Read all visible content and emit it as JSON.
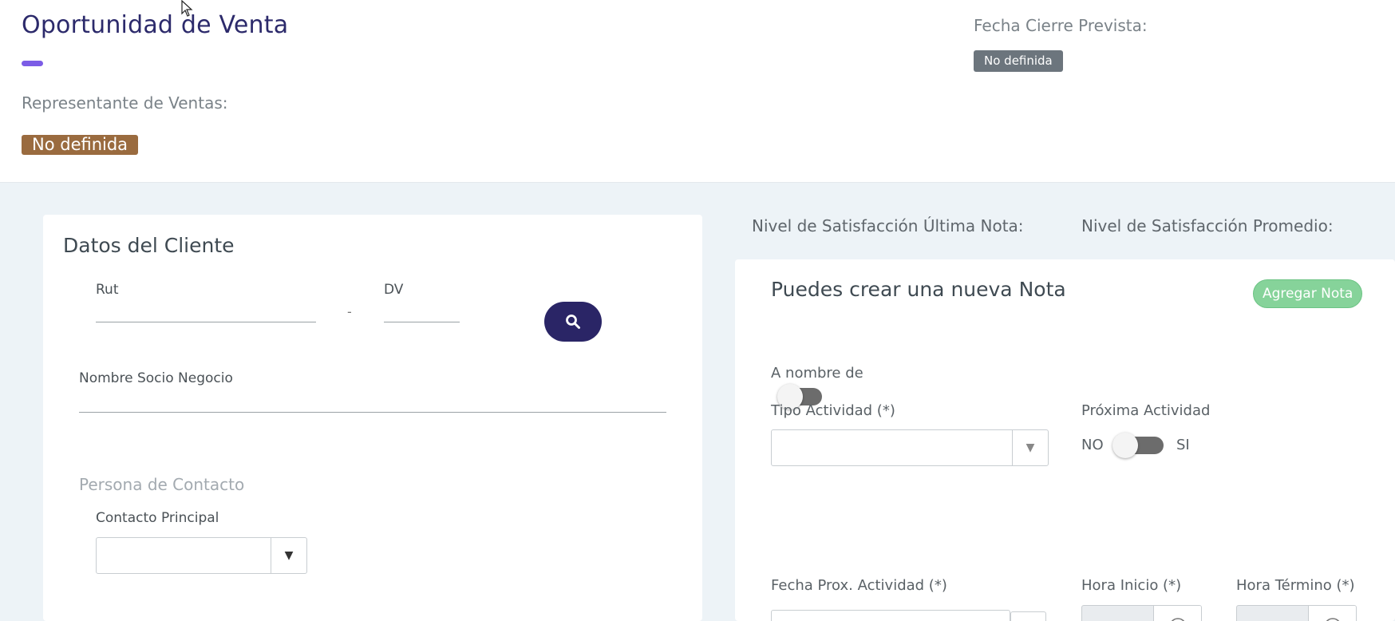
{
  "header": {
    "title": "Oportunidad de Venta",
    "sales_rep_label": "Representante de Ventas:",
    "sales_rep_value": "No definida",
    "close_date_label": "Fecha Cierre Prevista:",
    "close_date_value": "No definida",
    "accent_color": "#7c5ce6"
  },
  "client_card": {
    "title": "Datos del Cliente",
    "rut_label": "Rut",
    "rut_value": "",
    "separator": "-",
    "dv_label": "DV",
    "dv_value": "",
    "search_icon": "search-icon",
    "business_partner_label": "Nombre Socio Negocio",
    "business_partner_value": "",
    "contact_section": "Persona de Contacto",
    "main_contact_label": "Contacto Principal",
    "main_contact_value": ""
  },
  "satisfaction": {
    "last_note_label": "Nivel de Satisfacción Última Nota:",
    "average_label": "Nivel de Satisfacción Promedio:"
  },
  "note_card": {
    "title": "Puedes crear una nueva Nota",
    "add_button": "Agregar Nota",
    "on_behalf_label": "A nombre de",
    "on_behalf_toggle": false,
    "activity_type_label": "Tipo Actividad (*)",
    "activity_type_value": "",
    "next_activity_label": "Próxima Actividad",
    "next_activity_no": "NO",
    "next_activity_yes": "SI",
    "next_activity_toggle": false,
    "next_date_label": "Fecha Prox. Actividad (*)",
    "start_time_label": "Hora Inicio (*)",
    "end_time_label": "Hora Término (*)"
  },
  "colors": {
    "primary_dark": "#2a2566",
    "success": "#86d39a",
    "badge_brown": "#9a6b3f",
    "badge_gray": "#6c757d"
  }
}
